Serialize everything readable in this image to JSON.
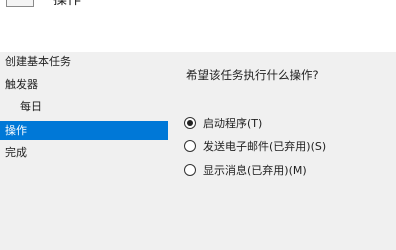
{
  "header": {
    "title": "操作",
    "icon": "task-icon"
  },
  "sidebar": {
    "steps": [
      {
        "label": "创建基本任务",
        "active": false,
        "sub": false
      },
      {
        "label": "触发器",
        "active": false,
        "sub": false
      },
      {
        "label": "每日",
        "active": false,
        "sub": true
      },
      {
        "label": "操作",
        "active": true,
        "sub": false
      },
      {
        "label": "完成",
        "active": false,
        "sub": false
      }
    ]
  },
  "main": {
    "question": "希望该任务执行什么操作?",
    "options": [
      {
        "label": "启动程序(T)",
        "checked": true
      },
      {
        "label": "发送电子邮件(已弃用)(S)",
        "checked": false
      },
      {
        "label": "显示消息(已弃用)(M)",
        "checked": false
      }
    ]
  },
  "colors": {
    "accent": "#0078d7",
    "background": "#f0f0f0",
    "header": "#ffffff"
  }
}
